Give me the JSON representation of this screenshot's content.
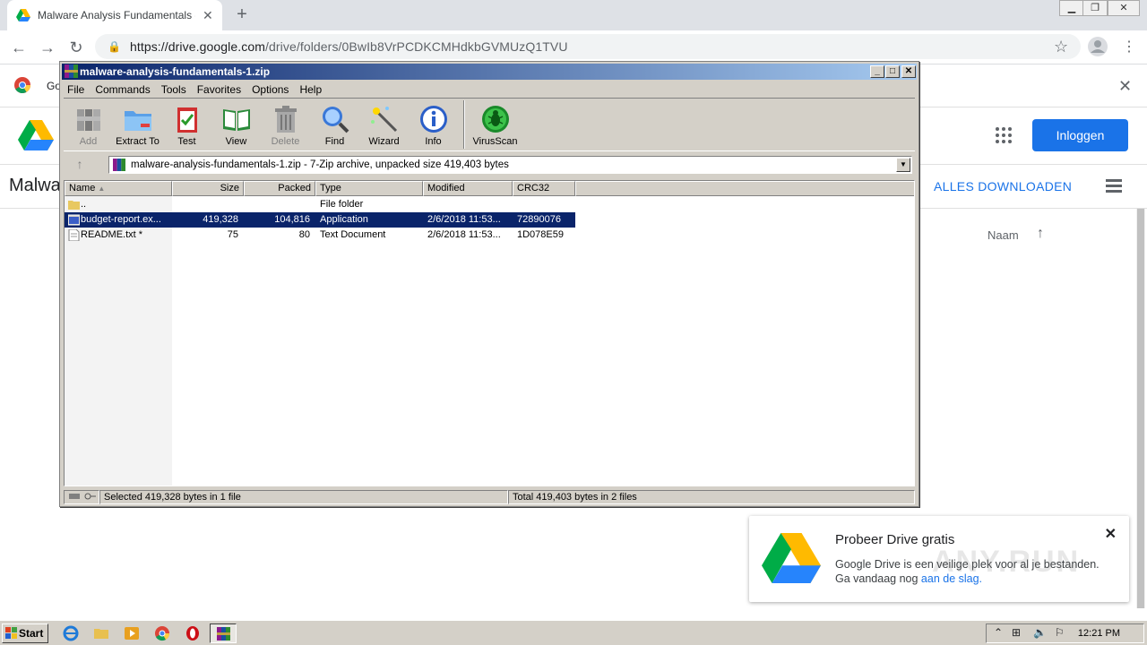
{
  "browser": {
    "tab_title": "Malware Analysis Fundamentals - Go",
    "url_host": "https://drive.google.com",
    "url_path": "/drive/folders/0BwIb8VrPCDKCMHdkbGVMUzQ1TVU",
    "bookmark_partial": "Go"
  },
  "drive": {
    "title_partial": "Malwa",
    "login_label": "Inloggen",
    "download_all_label": "ALLES DOWNLOADEN",
    "sort_label": "Naam"
  },
  "toast": {
    "title": "Probeer Drive gratis",
    "line1": "Google Drive is een veilige plek voor al je bestanden.",
    "line2_prefix": "Ga vandaag nog ",
    "line2_link": "aan de slag."
  },
  "watermark": "ANY.RUN",
  "winrar": {
    "title": "malware-analysis-fundamentals-1.zip",
    "menu": [
      "File",
      "Commands",
      "Tools",
      "Favorites",
      "Options",
      "Help"
    ],
    "tools": [
      {
        "label": "Add",
        "icon": "add-archive-icon",
        "enabled": false
      },
      {
        "label": "Extract To",
        "icon": "extract-folder-icon",
        "enabled": true
      },
      {
        "label": "Test",
        "icon": "test-clipboard-icon",
        "enabled": true
      },
      {
        "label": "View",
        "icon": "view-book-icon",
        "enabled": true
      },
      {
        "label": "Delete",
        "icon": "delete-trash-icon",
        "enabled": false
      },
      {
        "label": "Find",
        "icon": "find-magnifier-icon",
        "enabled": true
      },
      {
        "label": "Wizard",
        "icon": "wizard-wand-icon",
        "enabled": true
      },
      {
        "label": "Info",
        "icon": "info-icon",
        "enabled": true
      },
      {
        "label": "VirusScan",
        "icon": "virusscan-bug-icon",
        "enabled": true
      }
    ],
    "path": "malware-analysis-fundamentals-1.zip - 7-Zip archive, unpacked size 419,403 bytes",
    "columns": [
      "Name",
      "Size",
      "Packed",
      "Type",
      "Modified",
      "CRC32"
    ],
    "files": [
      {
        "name": "..",
        "size": "",
        "packed": "",
        "type": "File folder",
        "modified": "",
        "crc": "",
        "icon": "folder-icon",
        "selected": false
      },
      {
        "name": "budget-report.ex...",
        "size": "419,328",
        "packed": "104,816",
        "type": "Application",
        "modified": "2/6/2018 11:53...",
        "crc": "72890076",
        "icon": "application-icon",
        "selected": true
      },
      {
        "name": "README.txt *",
        "size": "75",
        "packed": "80",
        "type": "Text Document",
        "modified": "2/6/2018 11:53...",
        "crc": "1D078E59",
        "icon": "text-document-icon",
        "selected": false
      }
    ],
    "status_left": "Selected 419,328 bytes in 1 file",
    "status_right": "Total 419,403 bytes in 2 files"
  },
  "taskbar": {
    "start_label": "Start",
    "clock": "12:21 PM"
  }
}
